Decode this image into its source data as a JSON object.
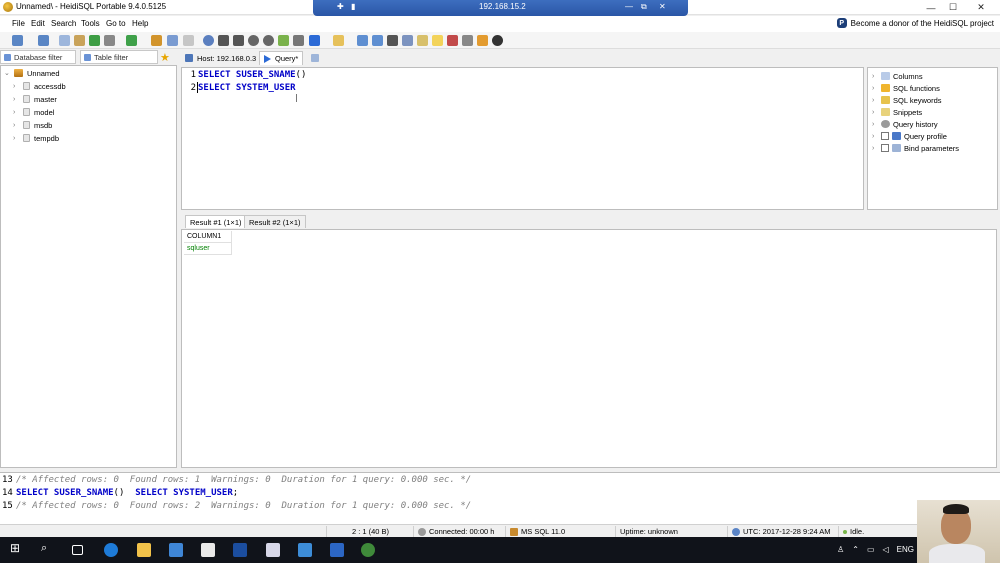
{
  "window": {
    "title": "Unnamed\\ - HeidiSQL Portable 9.4.0.5125",
    "controls": {
      "minimize": "—",
      "maximize": "☐",
      "close": "✕"
    }
  },
  "remote_bar": {
    "host": "192.168.15.2"
  },
  "menu": {
    "items": [
      "File",
      "Edit",
      "Search",
      "Tools",
      "Go to",
      "Help"
    ],
    "donor_label": "Become a donor of the HeidiSQL project"
  },
  "filters": {
    "database": "Database filter",
    "table": "Table filter"
  },
  "tree": {
    "root": "Unnamed",
    "databases": [
      "accessdb",
      "master",
      "model",
      "msdb",
      "tempdb"
    ]
  },
  "query_tabs": {
    "host": "Host: 192.168.0.3",
    "query": "Query*"
  },
  "editor": {
    "lines": [
      {
        "num": "1",
        "keyword": "SELECT SUSER_SNAME",
        "paren": "()"
      },
      {
        "num": "2",
        "keyword": "SELECT SYSTEM_USER",
        "paren": ""
      }
    ]
  },
  "helpers": {
    "items": [
      "Columns",
      "SQL functions",
      "SQL keywords",
      "Snippets",
      "Query history",
      "Query profile",
      "Bind parameters"
    ]
  },
  "result_tabs": [
    "Result #1 (1×1)",
    "Result #2 (1×1)"
  ],
  "grid": {
    "header": "COLUMN1",
    "value": "sqluser"
  },
  "log": {
    "line13": {
      "num": "13",
      "text": "/* Affected rows: 0  Found rows: 1  Warnings: 0  Duration for 1 query: 0.000 sec. */"
    },
    "line14": {
      "num": "14",
      "a": "SELECT SUSER_SNAME",
      "b": "()",
      "c": "  SELECT SYSTEM_USER",
      "d": ";"
    },
    "line15": {
      "num": "15",
      "text": "/* Affected rows: 0  Found rows: 2  Warnings: 0  Duration for 1 query: 0.000 sec. */"
    }
  },
  "status": {
    "position": "2 : 1 (40 B)",
    "connected": "Connected: 00:00 h",
    "server": "MS SQL 11.0",
    "uptime": "Uptime: unknown",
    "utc": "UTC: 2017-12-28 9:24 AM",
    "state": "Idle."
  },
  "taskbar": {
    "lang": "ENG"
  },
  "colors": {
    "keyword": "#0000c8",
    "comment": "#808080",
    "value": "#008000",
    "rdp": "#2a56a6"
  }
}
